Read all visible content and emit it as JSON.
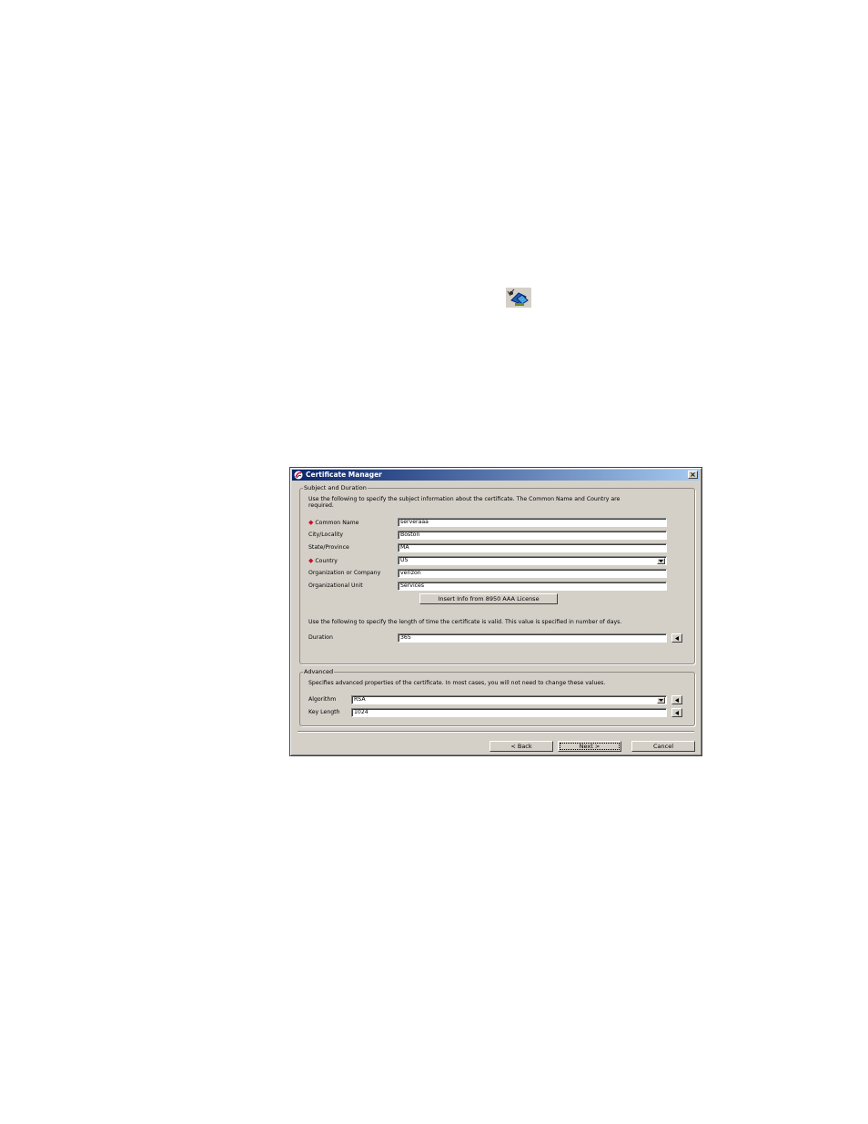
{
  "window": {
    "title": "Certificate Manager",
    "close_glyph": "×"
  },
  "icons": {
    "toolbar_icon": "certificate-wizard-icon",
    "app_icon": "app-logo-icon"
  },
  "subject": {
    "group_label": "Subject and Duration",
    "intro": "Use the following to specify the subject information about the certificate. The Common Name and Country are",
    "intro2": "required.",
    "common_name_label": "Common Name",
    "common_name_value": "serveraaa",
    "city_label": "City/Locality",
    "city_value": "Boston",
    "state_label": "State/Province",
    "state_value": "MA",
    "country_label": "Country",
    "country_value": "US",
    "org_label": "Organization or Company",
    "org_value": "verizon",
    "unit_label": "Organizational Unit",
    "unit_value": "Services",
    "insert_button": "Insert Info from 8950 AAA License",
    "duration_intro": "Use the following to specify the length of time the certificate is valid. This value is specified in number of days.",
    "duration_label": "Duration",
    "duration_value": "365"
  },
  "advanced": {
    "group_label": "Advanced",
    "intro": "Specifies advanced properties of the certificate. In most cases, you will not need to change these values.",
    "algorithm_label": "Algorithm",
    "algorithm_value": "RSA",
    "key_length_label": "Key Length",
    "key_length_value": "1024"
  },
  "footer": {
    "back": "< Back",
    "next": "Next >",
    "cancel": "Cancel"
  },
  "colors": {
    "titlebar_start": "#0a246a",
    "titlebar_end": "#a6caf0",
    "required_marker": "#c8102e",
    "dialog_bg": "#d4d0c8"
  }
}
